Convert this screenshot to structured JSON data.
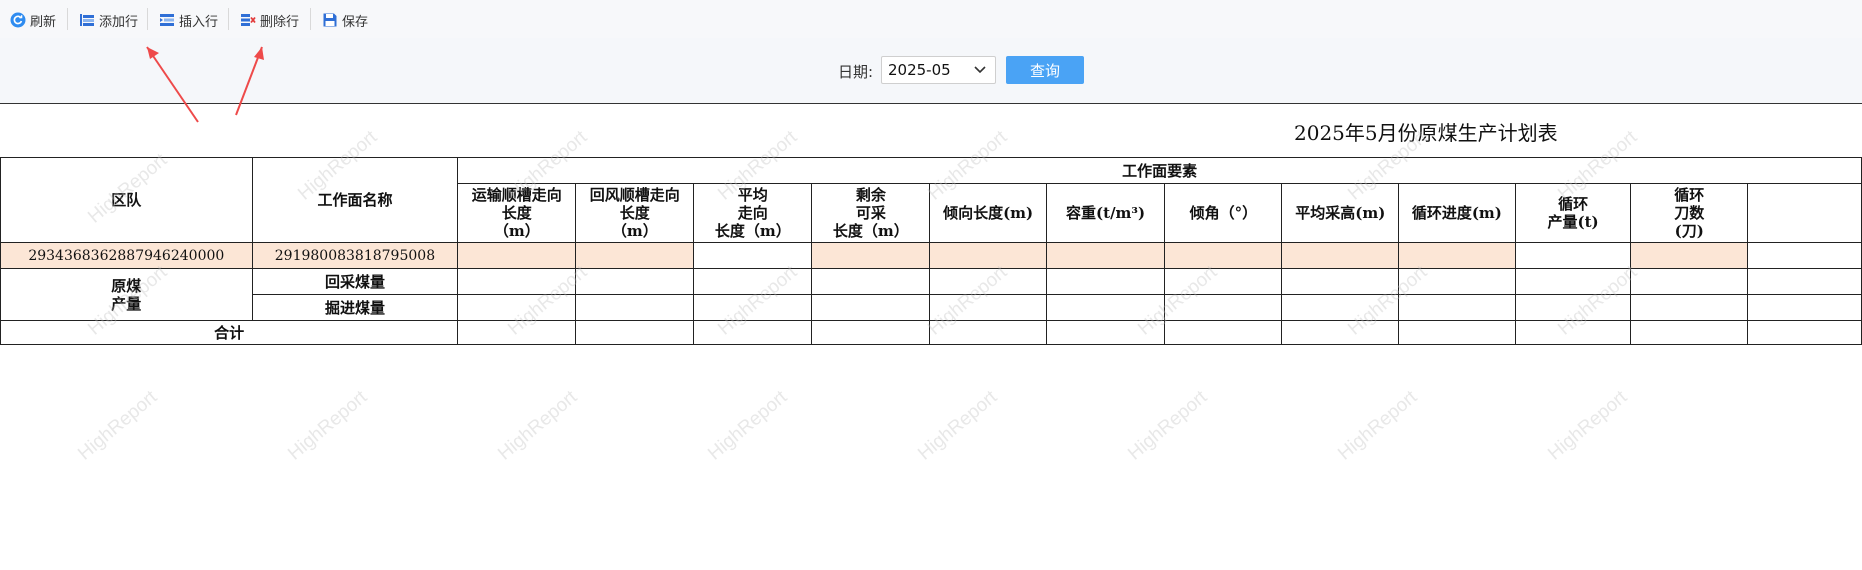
{
  "toolbar": {
    "refresh": "刷新",
    "add_row": "添加行",
    "insert_row": "插入行",
    "delete_row": "删除行",
    "save": "保存"
  },
  "query": {
    "date_label": "日期:",
    "date_value": "2025-05",
    "query_button": "查询"
  },
  "report": {
    "title": "2025年5月份原煤生产计划表",
    "watermark": "HighReport",
    "headers": {
      "team": "区队",
      "face_name": "工作面名称",
      "elements_group": "工作面要素",
      "cols": [
        "运输顺槽走向\n长度\n（m）",
        "回风顺槽走向\n长度\n（m）",
        "平均\n走向\n长度（m）",
        "剩余\n可采\n长度（m）",
        "倾向长度(m)",
        "容重(t/m³)",
        "倾角（°）",
        "平均采高(m)",
        "循环进度(m)",
        "循环\n产量(t)",
        "循环\n刀数\n(刀)"
      ]
    },
    "row1": {
      "team": "2934368362887946240000",
      "face": "291980083818795008"
    },
    "raw_coal": "原煤\n产量",
    "mining": "回采煤量",
    "tunneling": "掘进煤量",
    "total": "合计"
  }
}
